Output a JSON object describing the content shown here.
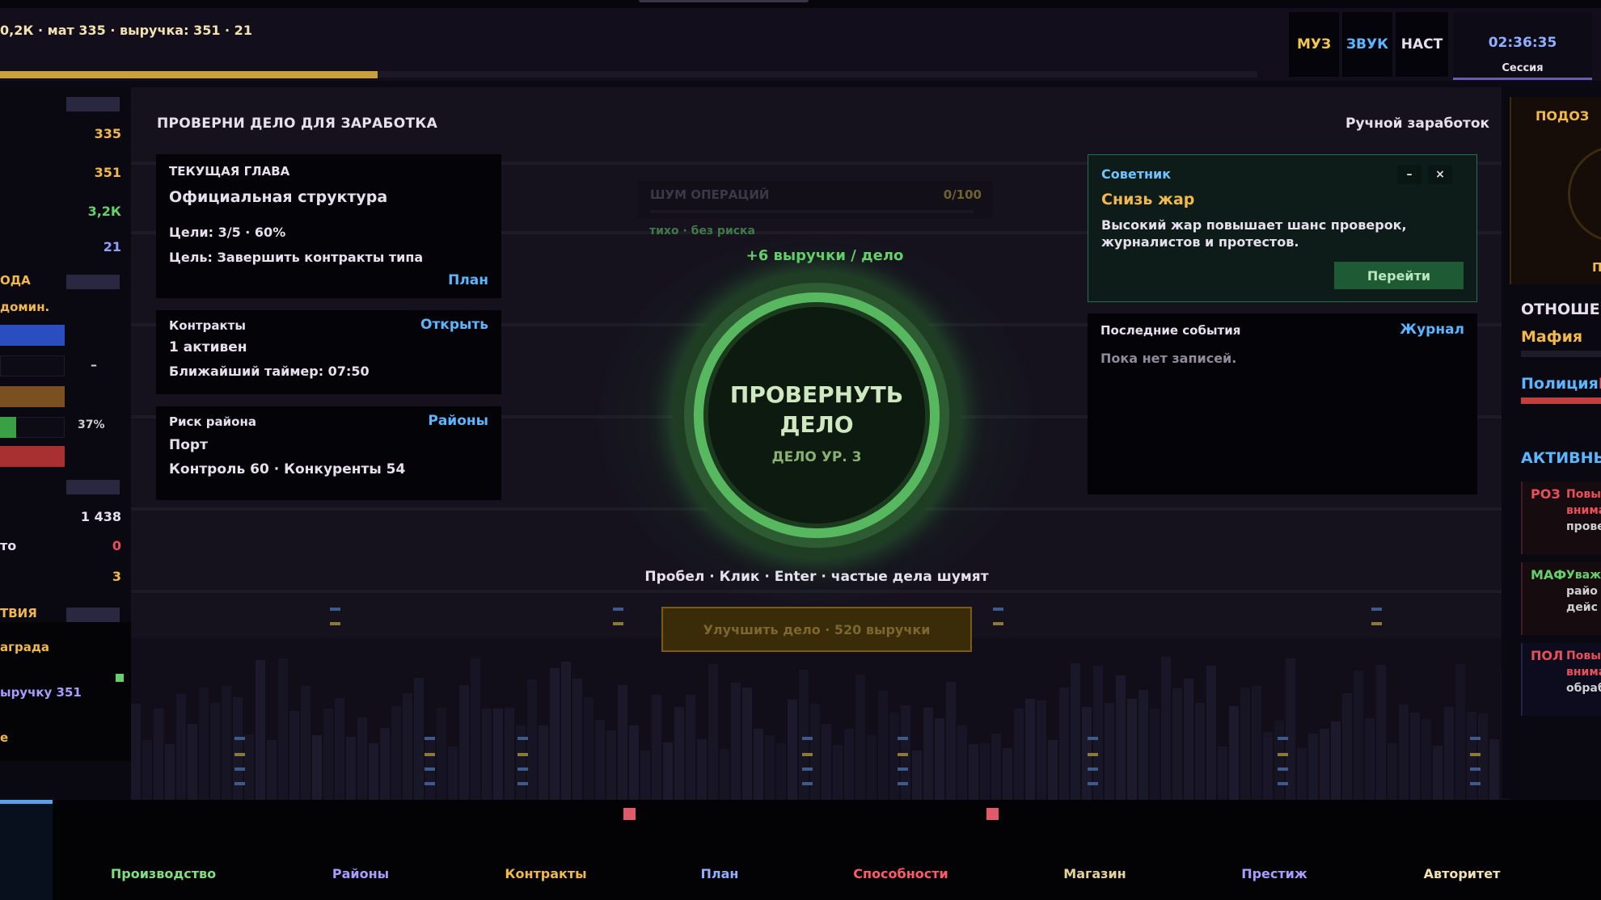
{
  "topbar": {
    "resources_line": "0,2К · мат 335 · выручка: 351 ·  21",
    "progress_fraction": 0.3,
    "buttons": [
      {
        "label": "МУЗ",
        "color": "#f2c94c"
      },
      {
        "label": "ЗВУК",
        "color": "#5bb6ff"
      },
      {
        "label": "НАСТ",
        "color": "#e6e0ee"
      }
    ],
    "clock": {
      "time": "02:36:35",
      "label": "Сессия"
    }
  },
  "left_panel": {
    "values": [
      "335",
      "351",
      "3,2К",
      "21"
    ],
    "section1_label": "ОДА",
    "section1_sub": "домин.",
    "dash": "–",
    "percent": "37%",
    "value_1438": "1 438",
    "row_label_to": "то",
    "row_value_0": "0",
    "row_value_3": "3",
    "section2_label": "ТВИЯ",
    "card": {
      "line1": "аграда",
      "line2": "ыручку 351",
      "line3": "е"
    }
  },
  "main": {
    "left_title": "ПРОВЕРНИ ДЕЛО ДЛЯ ЗАРАБОТКА",
    "right_title": "Ручной заработок",
    "chapter": {
      "header": "ТЕКУЩАЯ ГЛАВА",
      "title": "Официальная структура",
      "goals": "Цели: 3/5 · 60%",
      "goal": "Цель: Завершить контракты типа",
      "link": "План"
    },
    "contracts": {
      "header": "Контракты",
      "link": "Открыть",
      "active": "1 активен",
      "timer": "Ближайший таймер: 07:50"
    },
    "district": {
      "header": "Риск района",
      "link": "Районы",
      "name": "Порт",
      "stats": "Контроль 60 · Конкуренты 54"
    },
    "noise": {
      "label": "ШУМ ОПЕРАЦИЙ",
      "value": "0/100",
      "status": "тихо · без риска"
    },
    "per_case": "+6 выручки / дело",
    "big_button": {
      "title": "ПРОВЕРНУТЬ ДЕЛО",
      "sub": "ДЕЛО УР. 3"
    },
    "hint": "Пробел · Клик · Enter · частые дела шумят",
    "upgrade_button": "Улучшить дело ·  520 выручки",
    "advisor": {
      "header": "Советник",
      "title": "Снизь жар",
      "text": "Высокий жар повышает шанс проверок, журналистов и протестов.",
      "minimize": "–",
      "close": "×",
      "action": "Перейти"
    },
    "events": {
      "header": "Последние события",
      "link": "Журнал",
      "empty": "Пока нет записей."
    }
  },
  "right_panel": {
    "suspicion": "ПОДОЗ",
    "suspicion_sub": "ПО",
    "relations": "ОТНОШЕН",
    "mafia": "Мафия",
    "police": "Полиция",
    "police_mark": "П",
    "active": "АКТИВНЫ",
    "cards": [
      {
        "tag": "РОЗ",
        "l1": "Повы",
        "l2": "внима",
        "l3": "прове",
        "color": "#e8505a"
      },
      {
        "tag": "МАФ",
        "l1": "Уваж",
        "l2": "райо",
        "l3": "дейс",
        "color": "#66d06a"
      },
      {
        "tag": "ПОЛ",
        "l1": "Повы",
        "l2": "внима",
        "l3": "обраб",
        "color": "#e8505a"
      }
    ]
  },
  "bottom_nav": [
    {
      "label": "Производство",
      "color": "#7ee07e"
    },
    {
      "label": "Районы",
      "color": "#a89cff"
    },
    {
      "label": "Контракты",
      "color": "#f2b94a"
    },
    {
      "label": "План",
      "color": "#8fb0ff"
    },
    {
      "label": "Способности",
      "color": "#ff5a6a"
    },
    {
      "label": "Магазин",
      "color": "#e6d29a"
    },
    {
      "label": "Престиж",
      "color": "#a89cff"
    },
    {
      "label": "Авторитет",
      "color": "#f2e2b0"
    }
  ]
}
